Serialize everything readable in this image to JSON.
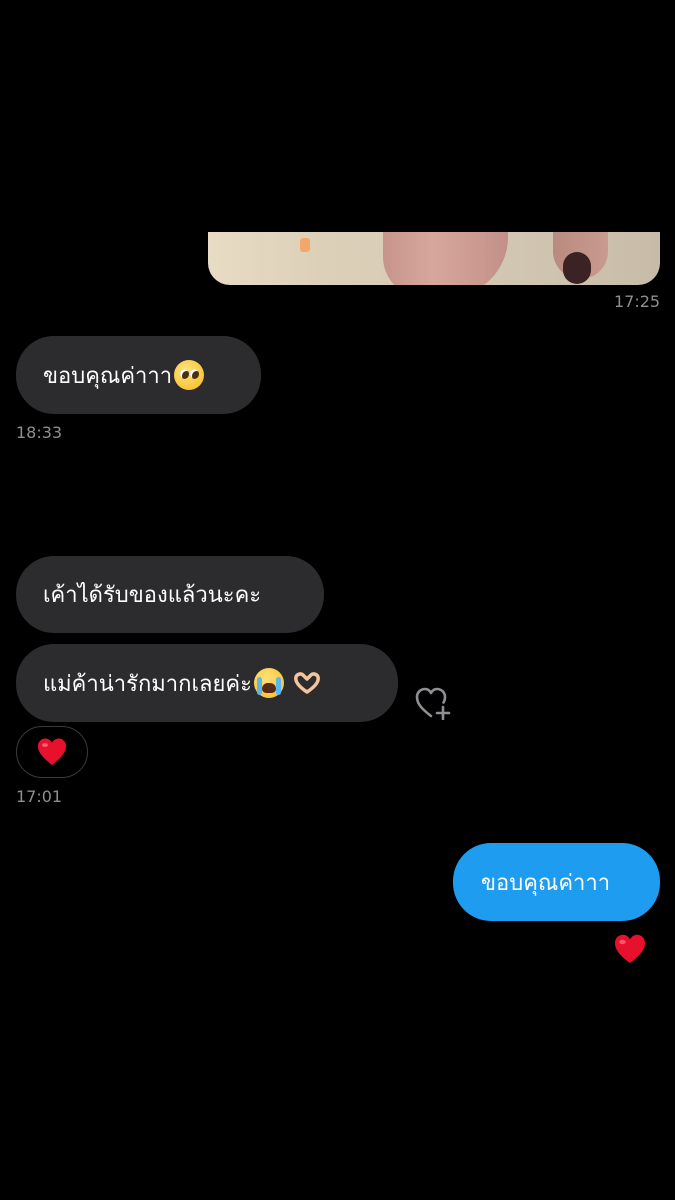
{
  "messages": {
    "photo_time": "17:25",
    "m1": {
      "text": "ขอบคุณค่าาา",
      "emoji": "pleading-face",
      "time": "18:33"
    },
    "m2": {
      "text": "เค้าได้รับของแล้วนะคะ"
    },
    "m3": {
      "text": "แม่ค้าน่ารักมากเลยค่ะ",
      "emoji": [
        "loudly-crying-face",
        "heart-hands"
      ],
      "reaction": "red-heart",
      "time": "17:01"
    },
    "m4": {
      "text": "ขอบคุณค่าาา",
      "reaction": "red-heart"
    }
  },
  "colors": {
    "background": "#000000",
    "incoming_bubble": "#2c2c2e",
    "outgoing_bubble": "#1e9cf0",
    "timestamp": "#8e8e93",
    "heart": "#e8112d"
  },
  "icons": {
    "add_reaction": "heart-plus-icon",
    "reaction": "heart-icon"
  }
}
